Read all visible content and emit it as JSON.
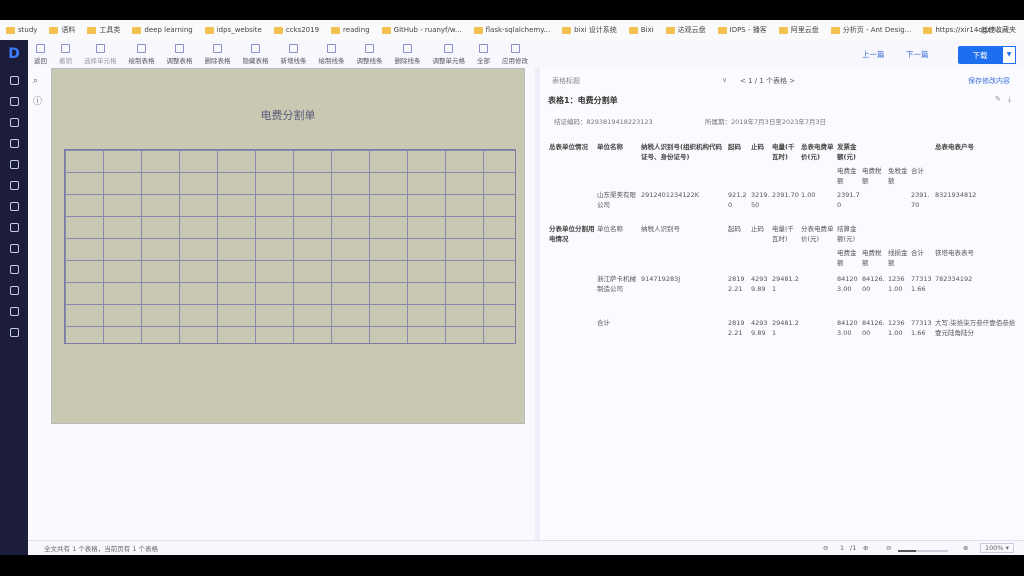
{
  "bookmarks": [
    "study",
    "语料",
    "工具类",
    "deep learning",
    "idps_website",
    "ccks2019",
    "reading",
    "GitHub - ruanyf/w...",
    "flask-sqlalchemy...",
    "bixi 设计系统",
    "Bixi",
    "达观云盘",
    "IDPS - 播客",
    "阿里云盘",
    "分析页 - Ant Desig...",
    "https://xir14ogz7..."
  ],
  "bookmarks_other": "其他收藏夹",
  "toolbar": [
    "返回",
    "撤销",
    "选择单元格",
    "绘制表格",
    "调整表格",
    "删除表格",
    "隐藏表格",
    "新增线条",
    "绘制线条",
    "调整线条",
    "删除线条",
    "调整单元格",
    "全部",
    "应用修改"
  ],
  "nav": {
    "prev": "上一篇",
    "next": "下一篇",
    "download": "下载"
  },
  "scan": {
    "title": "电费分割单"
  },
  "right": {
    "title_placeholder": "表格标题",
    "pager": "< 1 / 1 个表格 >",
    "save": "保存修改内容",
    "table_title": "表格1：电费分割单",
    "meta_left": "结证编码：8293819418223123",
    "meta_right": "所属期：2019年7月3日至2023年7月3日",
    "rows": [
      [
        "总表单位情况",
        "单位名称",
        "纳税人识别号(组织机构代码证号、身份证号)",
        "起码",
        "止码",
        "电量(千瓦时)",
        "总表电费单价(元)",
        "发票金额(元)",
        "",
        "",
        "",
        "总表电表户号"
      ],
      [
        "",
        "",
        "",
        "",
        "",
        "",
        "",
        "电费金额",
        "电费税额",
        "免税金额",
        "合计",
        ""
      ],
      [
        "",
        "山东渠美有限公司",
        "2912401234122K",
        "921.20",
        "3219.50",
        "2391.70",
        "1.00",
        "2391.70",
        "",
        "",
        "2391.70",
        "8321934812"
      ],
      [
        "分表单位分割用电情况",
        "单位名称",
        "纳税人识别号",
        "起码",
        "止码",
        "电量(千瓦时)",
        "分表电费单价(元)",
        "结算金额(元)",
        "",
        "",
        "",
        ""
      ],
      [
        "",
        "",
        "",
        "",
        "",
        "",
        "",
        "电费金额",
        "电费税额",
        "线损金额",
        "合计",
        "铁塔电表表号"
      ],
      [
        "",
        "浙江萨卡机械制造公司",
        "914719283J",
        "28192.21",
        "42939.89",
        "29481.21",
        "",
        "841203.00",
        "84126.00",
        "12361.00",
        "773131.66",
        "782334192"
      ],
      [
        "",
        "合计",
        "",
        "28192.21",
        "42939.89",
        "29481.21",
        "",
        "841203.00",
        "84126.00",
        "12361.00",
        "773131.66",
        "大写:柒拾柒万叁仟壹佰叁拾壹元陆角陆分"
      ]
    ]
  },
  "status": {
    "summary": "全文共有 1 个表格，当前页有 1 个表格",
    "page": "1",
    "total": "/1",
    "zoom": "100%"
  }
}
